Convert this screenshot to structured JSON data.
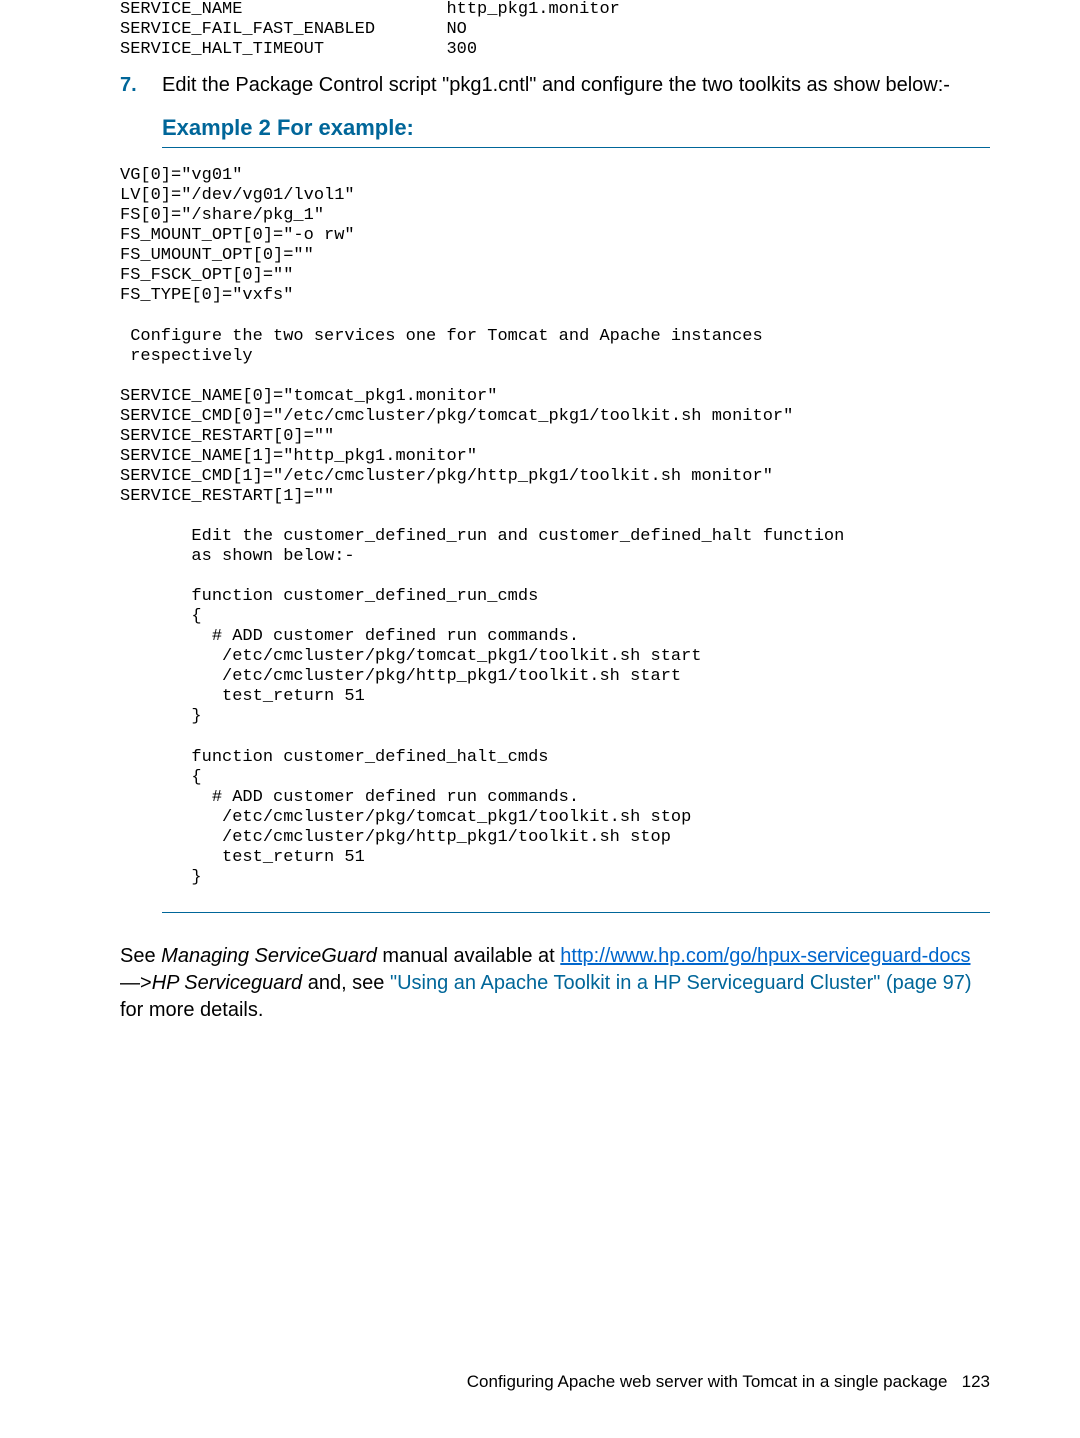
{
  "top_code": "SERVICE_NAME                    http_pkg1.monitor\nSERVICE_FAIL_FAST_ENABLED       NO\nSERVICE_HALT_TIMEOUT            300",
  "step": {
    "num": "7.",
    "text": "Edit the Package Control script \"pkg1.cntl\" and configure the two toolkits as show below:-"
  },
  "example_title": "Example 2 For example:",
  "example_code": "VG[0]=\"vg01\"\nLV[0]=\"/dev/vg01/lvol1\"\nFS[0]=\"/share/pkg_1\"\nFS_MOUNT_OPT[0]=\"-o rw\"\nFS_UMOUNT_OPT[0]=\"\"\nFS_FSCK_OPT[0]=\"\"\nFS_TYPE[0]=\"vxfs\"\n\n Configure the two services one for Tomcat and Apache instances\n respectively\n\nSERVICE_NAME[0]=\"tomcat_pkg1.monitor\"\nSERVICE_CMD[0]=\"/etc/cmcluster/pkg/tomcat_pkg1/toolkit.sh monitor\"\nSERVICE_RESTART[0]=\"\"\nSERVICE_NAME[1]=\"http_pkg1.monitor\"\nSERVICE_CMD[1]=\"/etc/cmcluster/pkg/http_pkg1/toolkit.sh monitor\"\nSERVICE_RESTART[1]=\"\"\n\n       Edit the customer_defined_run and customer_defined_halt function\n       as shown below:-\n\n       function customer_defined_run_cmds\n       {\n         # ADD customer defined run commands.\n          /etc/cmcluster/pkg/tomcat_pkg1/toolkit.sh start\n          /etc/cmcluster/pkg/http_pkg1/toolkit.sh start\n          test_return 51\n       }\n\n       function customer_defined_halt_cmds\n       {\n         # ADD customer defined run commands.\n          /etc/cmcluster/pkg/tomcat_pkg1/toolkit.sh stop\n          /etc/cmcluster/pkg/http_pkg1/toolkit.sh stop\n          test_return 51\n       }",
  "closing": {
    "pre": "See ",
    "manual": "Managing ServiceGuard",
    "mid1": " manual available at ",
    "link": "http://www.hp.com/go/hpux-serviceguard-docs",
    "arrow": " —>",
    "hp": "HP Serviceguard",
    "mid2": "  and, see ",
    "teal": "\"Using an Apache Toolkit in a HP Serviceguard Cluster\" (page 97)",
    "post": " for more details."
  },
  "footer": {
    "text": "Configuring Apache web server with Tomcat in a single package",
    "page": "123"
  }
}
